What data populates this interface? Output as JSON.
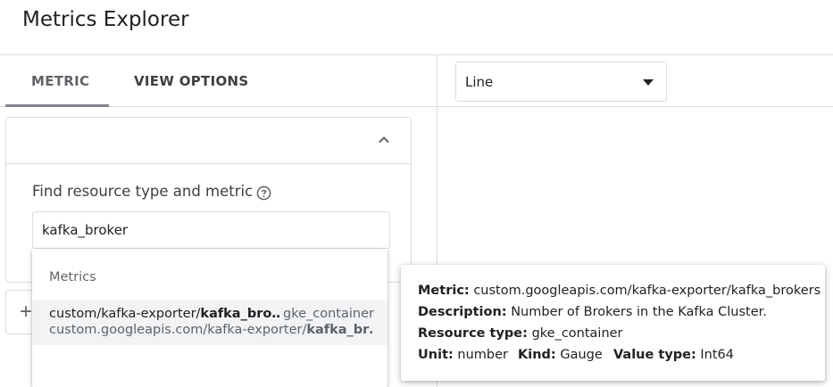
{
  "header": {
    "title": "Metrics Explorer"
  },
  "tabs": [
    {
      "label": "METRIC",
      "active": true
    },
    {
      "label": "VIEW OPTIONS",
      "active": false
    }
  ],
  "finder": {
    "label": "Find resource type and metric",
    "help_icon": "help-circle-icon",
    "collapse_icon": "chevron-up-icon",
    "input_value": "kafka_broker"
  },
  "add_icon": "plus-icon",
  "chart_type": {
    "selected": "Line",
    "icon": "dropdown-arrow-icon"
  },
  "suggestions": {
    "section_title": "Metrics",
    "items": [
      {
        "name_prefix": "custom/kafka-exporter/",
        "name_bold": "kafka_bro…",
        "resource": "gke_container",
        "full_prefix": "custom.googleapis.com/kafka-exporter/",
        "full_bold": "kafka_br…"
      }
    ]
  },
  "tooltip": {
    "metric_label": "Metric:",
    "metric_value": "custom.googleapis.com/kafka-exporter/kafka_brokers",
    "description_label": "Description:",
    "description_value": "Number of Brokers in the Kafka Cluster.",
    "resource_label": "Resource type:",
    "resource_value": "gke_container",
    "unit_label": "Unit:",
    "unit_value": "number",
    "kind_label": "Kind:",
    "kind_value": "Gauge",
    "value_type_label": "Value type:",
    "value_type_value": "Int64"
  },
  "colors": {
    "border": "#dadce0",
    "text_primary": "#202124",
    "text_secondary": "#5f6368",
    "hover_bg": "#f1f3f4"
  }
}
